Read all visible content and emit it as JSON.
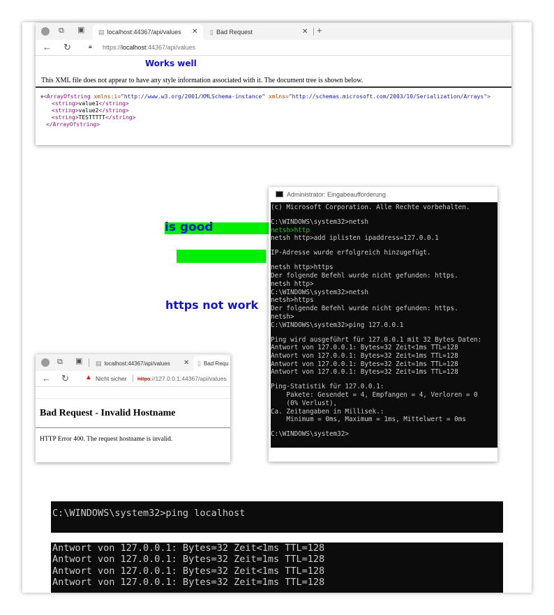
{
  "browser1": {
    "tab1_title": "localhost:44367/api/values",
    "tab2_title": "Bad Request",
    "url_prefix": "https://",
    "url_host": "localhost",
    "url_rest": ":44367/api/values",
    "annotation": "Works well",
    "info": "This XML file does not appear to have any style information associated with it. The document tree is shown below.",
    "xml": {
      "open_tag": "<ArrayOfstring",
      "attr1_name": "xmlns:i=",
      "attr1_val": "\"http://www.w3.org/2001/XMLSchema-instance\"",
      "attr2_name": "xmlns=",
      "attr2_val": "\"http://schemas.microsoft.com/2003/10/Serialization/Arrays\"",
      "open_end": ">",
      "str_open": "<string>",
      "str_close": "</string>",
      "values": [
        "value1",
        "value2",
        "TESTTTTT"
      ],
      "close_tag": "</ArrayOfstring>"
    }
  },
  "annotations": {
    "is_good": "is good",
    "https_not_work": "https not work"
  },
  "cmd1": {
    "title": "Administrator: Eingabeaufforderung",
    "lines": [
      "(c) Microsoft Corporation. Alle Rechte vorbehalten.",
      "",
      "C:\\WINDOWS\\system32>netsh",
      "netsh>http",
      "netsh http>add iplisten ipaddress=127.0.0.1",
      "",
      "IP-Adresse wurde erfolgreich hinzugefügt.",
      "",
      "netsh http>https",
      "Der folgende Befehl wurde nicht gefunden: https.",
      "netsh http>",
      "C:\\WINDOWS\\system32>netsh",
      "netsh>https",
      "Der folgende Befehl wurde nicht gefunden: https.",
      "netsh>",
      "C:\\WINDOWS\\system32>ping 127.0.0.1",
      "",
      "Ping wird ausgeführt für 127.0.0.1 mit 32 Bytes Daten:",
      "Antwort von 127.0.0.1: Bytes=32 Zeit<1ms TTL=128",
      "Antwort von 127.0.0.1: Bytes=32 Zeit=1ms TTL=128",
      "Antwort von 127.0.0.1: Bytes=32 Zeit=1ms TTL=128",
      "Antwort von 127.0.0.1: Bytes=32 Zeit=1ms TTL=128",
      "",
      "Ping-Statistik für 127.0.0.1:",
      "    Pakete: Gesendet = 4, Empfangen = 4, Verloren = 0",
      "    (0% Verlust),",
      "Ca. Zeitangaben in Millisek.:",
      "    Minimum = 0ms, Maximum = 1ms, Mittelwert = 0ms",
      "",
      "C:\\WINDOWS\\system32>"
    ]
  },
  "browser2": {
    "tab1_title": "localhost:44367/api/values",
    "tab2_title": "Bad Requ",
    "security_label": "Nicht sicher",
    "url_https": "https",
    "url_rest": "://127.0.0.1:44367/api/values",
    "heading": "Bad Request - Invalid Hostname",
    "error_text": "HTTP Error 400. The request hostname is invalid."
  },
  "cmd2": {
    "prompt_line": "C:\\WINDOWS\\system32>ping localhost",
    "reply_lines": [
      "Antwort von 127.0.0.1: Bytes=32 Zeit<1ms TTL=128",
      "Antwort von 127.0.0.1: Bytes=32 Zeit=1ms TTL=128",
      "Antwort von 127.0.0.1: Bytes=32 Zeit<1ms TTL=128",
      "Antwort von 127.0.0.1: Bytes=32 Zeit=1ms TTL=128"
    ]
  },
  "colors": {
    "annotation_blue": "#1515c8",
    "highlight_green": "#00ee00",
    "console_bg": "#0c0c0c",
    "console_text": "#cccccc",
    "console_green": "#16c60c"
  }
}
